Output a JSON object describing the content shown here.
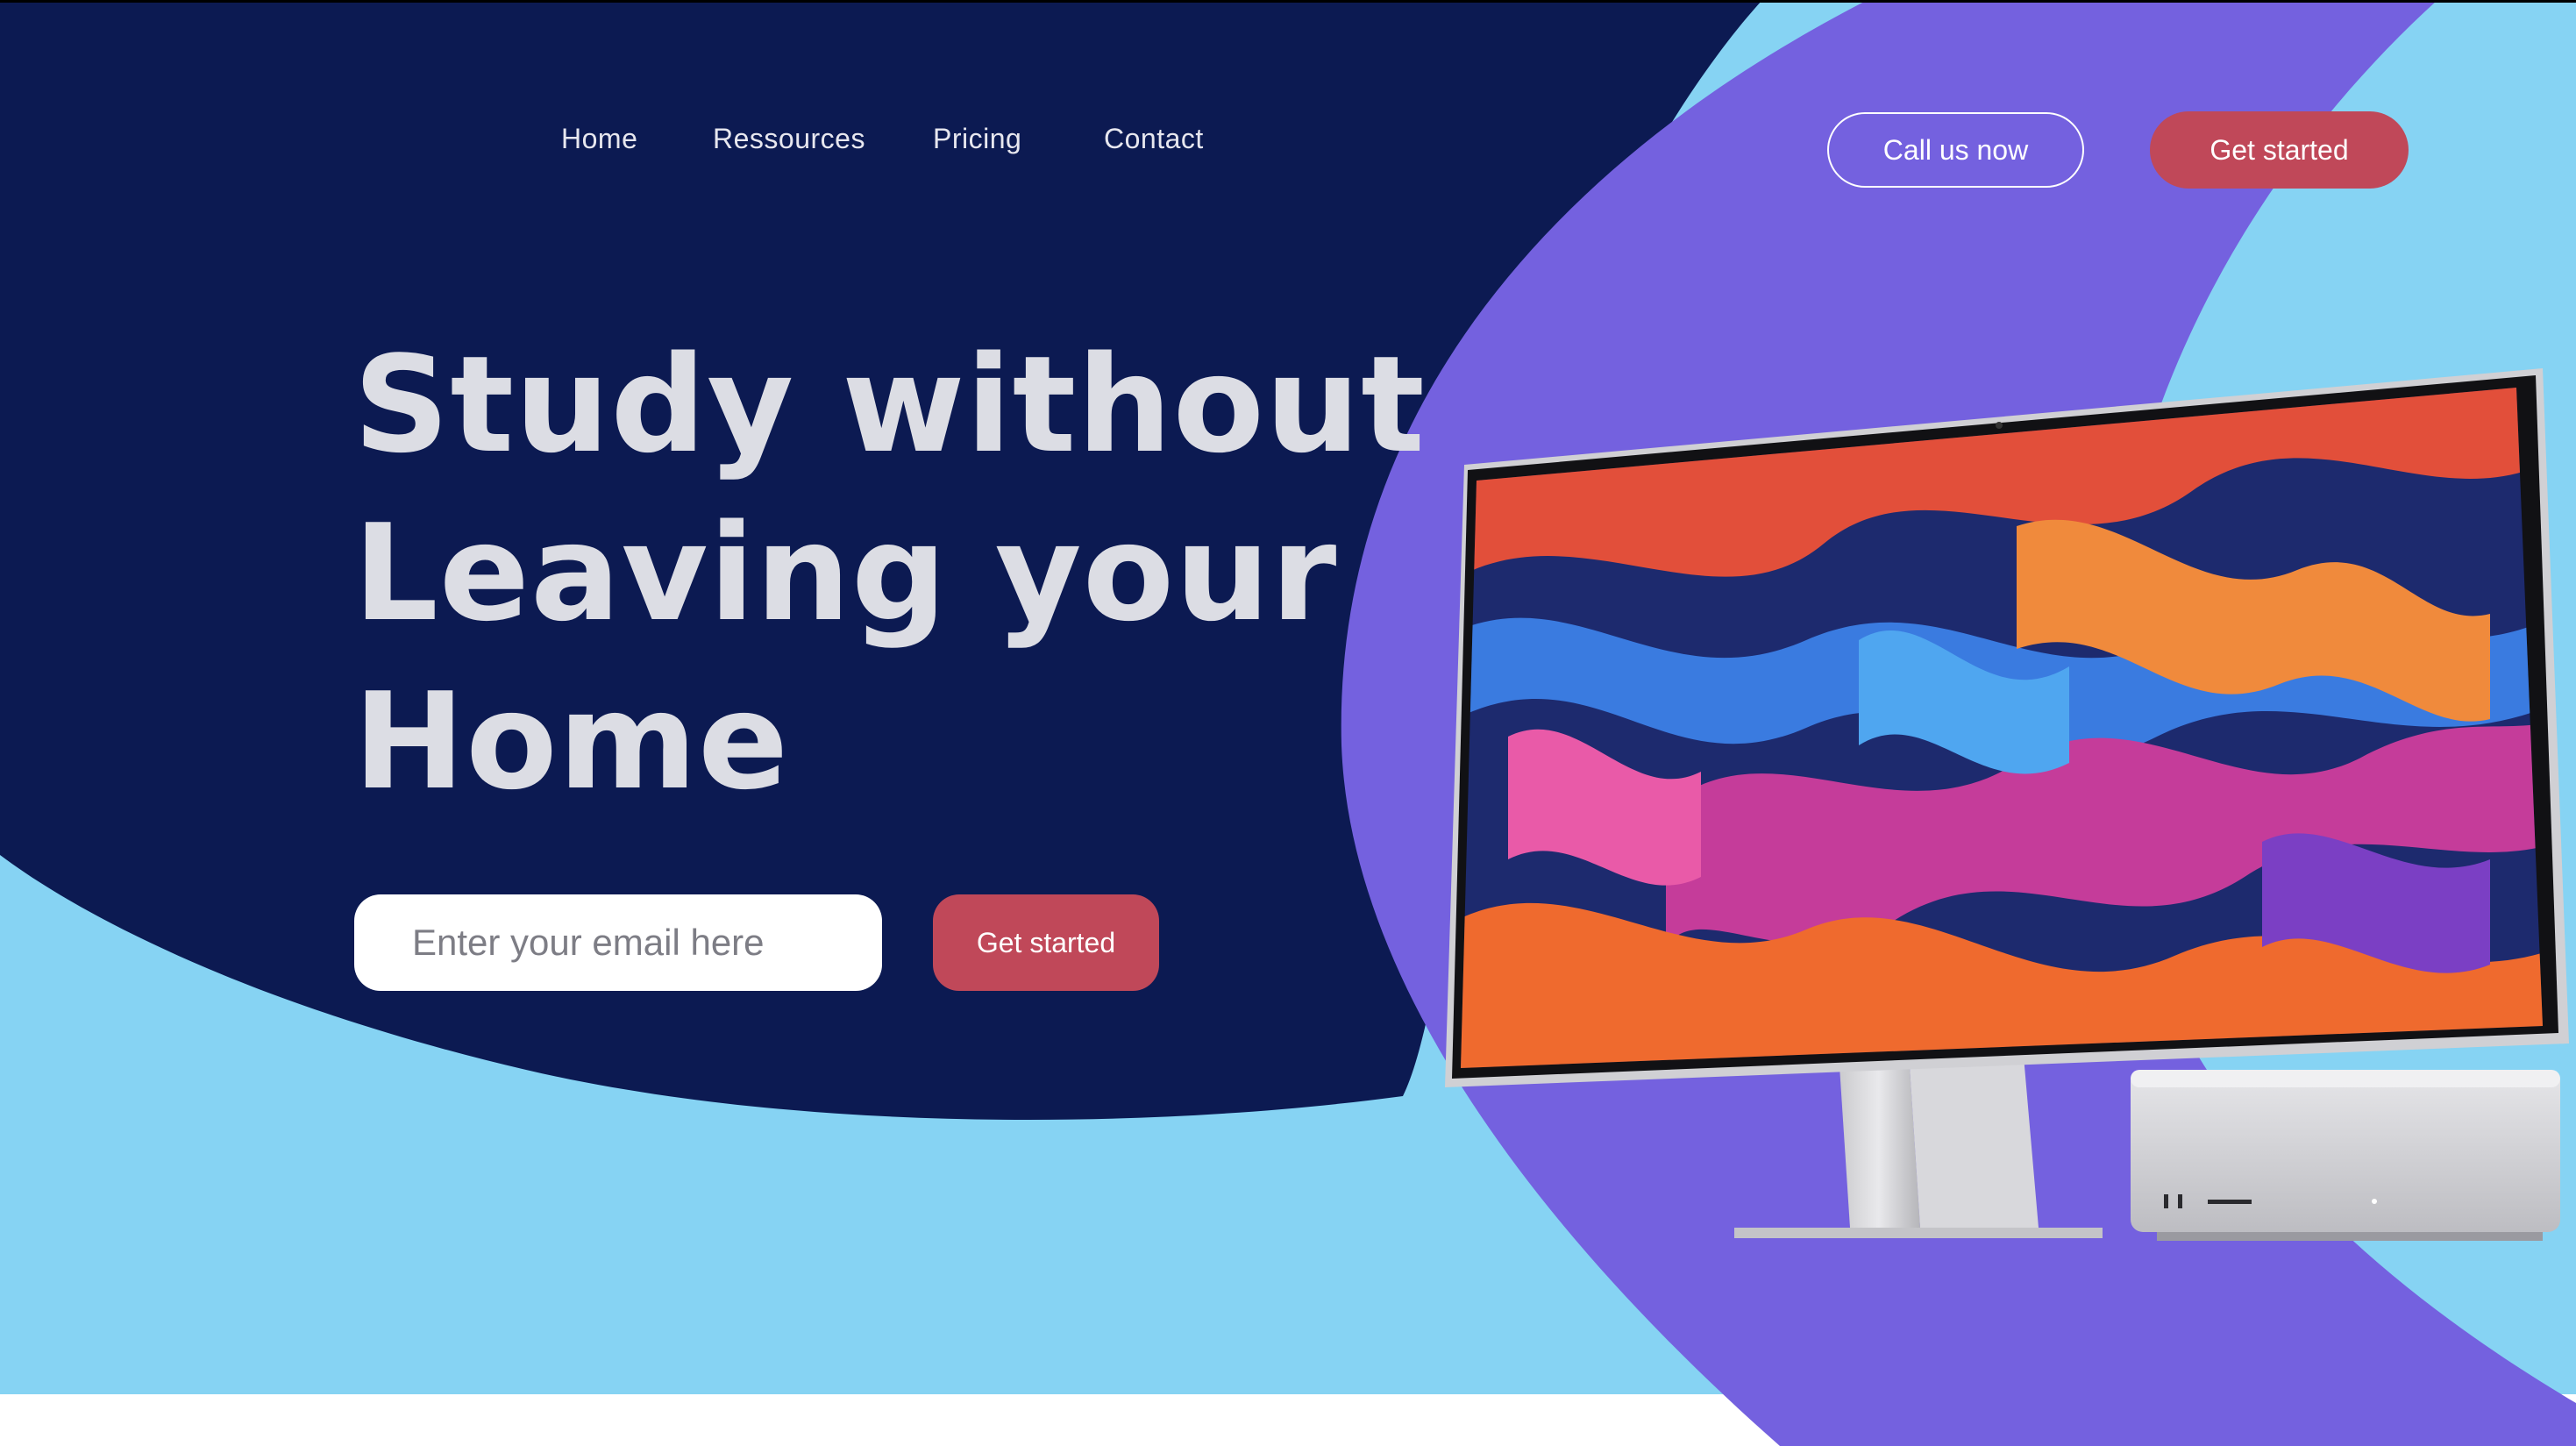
{
  "nav": {
    "links": [
      "Home",
      "Ressources",
      "Pricing",
      "Contact"
    ]
  },
  "header_actions": {
    "call_label": "Call us now",
    "get_started_label": "Get started"
  },
  "hero": {
    "headline_lines": [
      "Study without",
      "Leaving your",
      "Home"
    ],
    "email_placeholder": "Enter your email here",
    "cta_label": "Get started"
  },
  "colors": {
    "navy": "#0c1a52",
    "purple": "#7461df",
    "light_blue": "#86d3f3",
    "accent_red": "#c04859",
    "white": "#ffffff"
  }
}
